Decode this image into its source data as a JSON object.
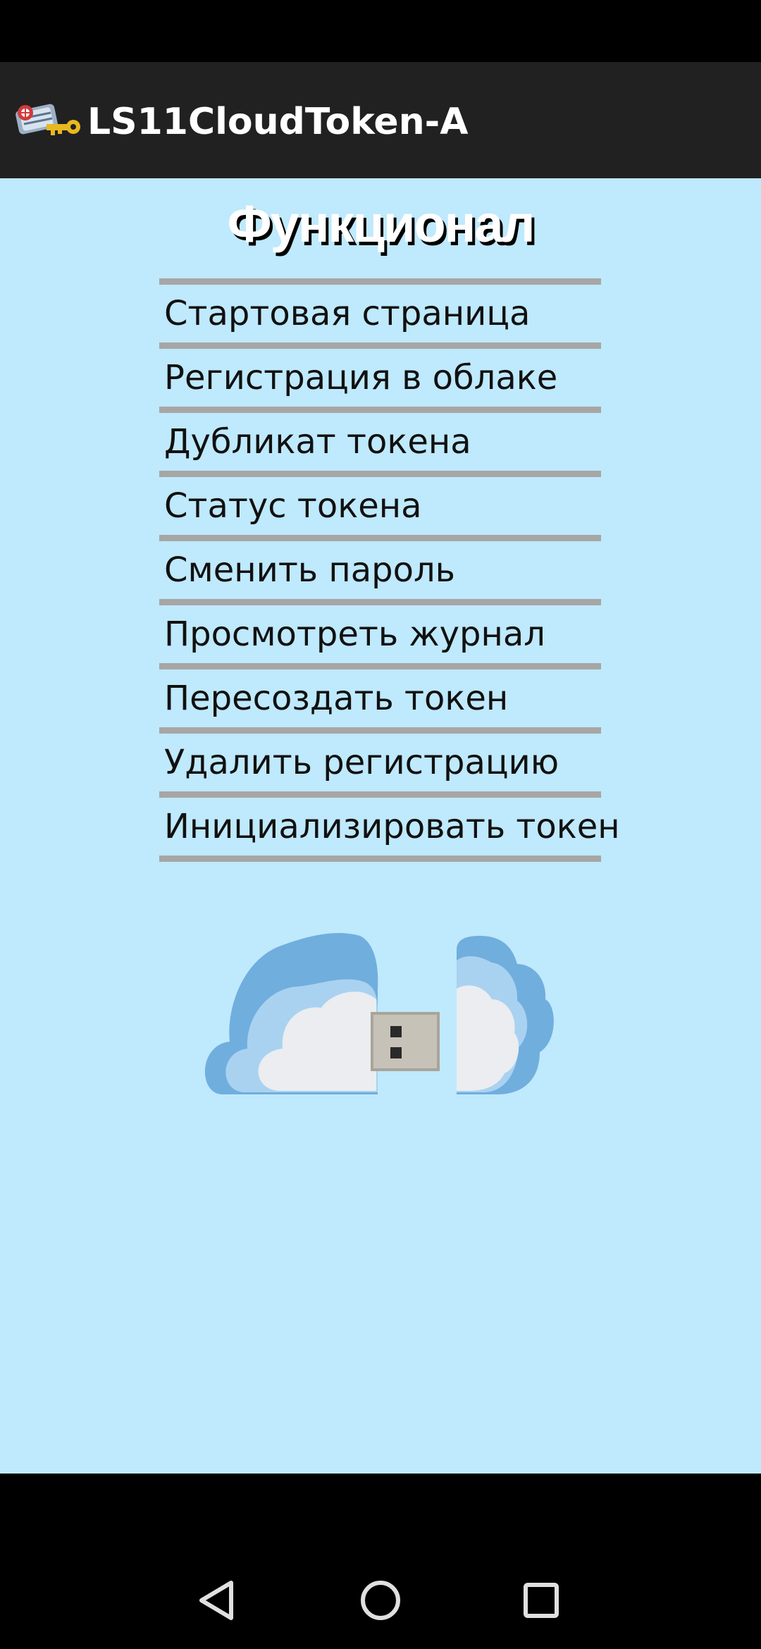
{
  "app_bar": {
    "title": "LS11CloudToken-A",
    "icon": "key-token-icon"
  },
  "main": {
    "heading": "Функционал",
    "menu_items": [
      {
        "label": "Стартовая страница"
      },
      {
        "label": "Регистрация в облаке"
      },
      {
        "label": "Дубликат токена"
      },
      {
        "label": "Статус токена"
      },
      {
        "label": "Сменить пароль"
      },
      {
        "label": "Просмотреть журнал"
      },
      {
        "label": "Пересоздать токен"
      },
      {
        "label": "Удалить регистрацию"
      },
      {
        "label": "Инициализировать токен"
      }
    ],
    "illustration": "cloud-usb-token-icon"
  },
  "nav_bar": {
    "buttons": [
      "back-icon",
      "home-icon",
      "recents-icon"
    ]
  },
  "colors": {
    "app_bar_bg": "#212121",
    "content_bg": "#bfe9fc",
    "divider": "#a6a6a6",
    "system_bars": "#000000"
  }
}
